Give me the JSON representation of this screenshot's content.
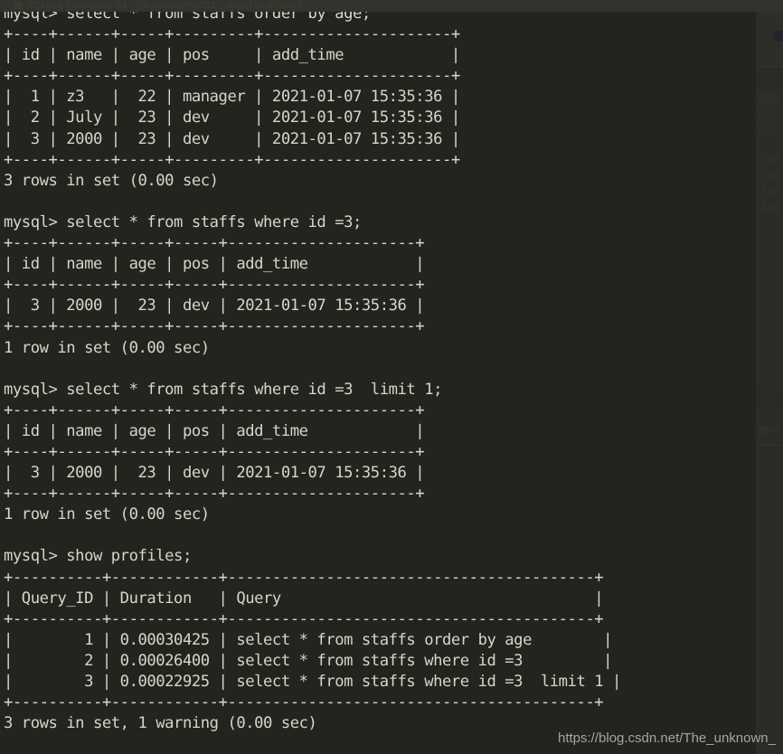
{
  "window": {
    "title": "SQLyog Enterprise 64 - [demo3/demo012 - root@localhost*]",
    "background_color": "#2b2b27",
    "console_background_color": "#24241f",
    "console_text_color": "#d6d6cd"
  },
  "watermark": {
    "text": "https://blog.csdn.net/The_unknown_"
  },
  "terminal": {
    "prompt": "mysql> ",
    "blocks": [
      {
        "name": "select-order-by-age",
        "command": "mysql> select * from staffs order by age;",
        "separator": "+----+------+-----+---------+---------------------+",
        "header": "| id | name | age | pos     | add_time            |",
        "rows": [
          "|  1 | z3   |  22 | manager | 2021-01-07 15:35:36 |",
          "|  2 | July |  23 | dev     | 2021-01-07 15:35:36 |",
          "|  3 | 2000 |  23 | dev     | 2021-01-07 15:35:36 |"
        ],
        "status": "3 rows in set (0.00 sec)"
      },
      {
        "name": "select-where-id-3",
        "command": "mysql> select * from staffs where id =3;",
        "separator": "+----+------+-----+-----+---------------------+",
        "header": "| id | name | age | pos | add_time            |",
        "rows": [
          "|  3 | 2000 |  23 | dev | 2021-01-07 15:35:36 |"
        ],
        "status": "1 row in set (0.00 sec)"
      },
      {
        "name": "select-where-id-3-limit-1",
        "command": "mysql> select * from staffs where id =3  limit 1;",
        "separator": "+----+------+-----+-----+---------------------+",
        "header": "| id | name | age | pos | add_time            |",
        "rows": [
          "|  3 | 2000 |  23 | dev | 2021-01-07 15:35:36 |"
        ],
        "status": "1 row in set (0.00 sec)"
      },
      {
        "name": "show-profiles",
        "command": "mysql> show profiles;",
        "separator": "+----------+------------+-----------------------------------------+",
        "header": "| Query_ID | Duration   | Query                                   |",
        "rows": [
          "|        1 | 0.00030425 | select * from staffs order by age       |",
          "|        2 | 0.00026400 | select * from staffs where id =3        |",
          "|        3 | 0.00022925 | select * from staffs where id =3  limit 1 |"
        ],
        "status": "3 rows in set, 1 warning (0.00 sec)"
      }
    ],
    "profiles_table": {
      "columns": [
        "Query_ID",
        "Duration",
        "Query"
      ],
      "data": [
        {
          "query_id": "1",
          "duration": "0.00030425",
          "query": "select * from staffs order by age"
        },
        {
          "query_id": "2",
          "duration": "0.00026400",
          "query": "select * from staffs where id =3"
        },
        {
          "query_id": "3",
          "duration": "0.00022925",
          "query": "select * from staffs where id =3  limit 1"
        }
      ]
    },
    "staffs_table": {
      "columns": [
        "id",
        "name",
        "age",
        "pos",
        "add_time"
      ],
      "data": [
        {
          "id": "1",
          "name": "z3",
          "age": "22",
          "pos": "manager",
          "add_time": "2021-01-07 15:35:36"
        },
        {
          "id": "2",
          "name": "July",
          "age": "23",
          "pos": "dev",
          "add_time": "2021-01-07 15:35:36"
        },
        {
          "id": "3",
          "name": "2000",
          "age": "23",
          "pos": "dev",
          "add_time": "2021-01-07 15:35:36"
        }
      ]
    },
    "screen_text": "mysql> select * from staffs order by age;\n+----+------+-----+---------+---------------------+\n| id | name | age | pos     | add_time            |\n+----+------+-----+---------+---------------------+\n|  1 | z3   |  22 | manager | 2021-01-07 15:35:36 |\n|  2 | July |  23 | dev     | 2021-01-07 15:35:36 |\n|  3 | 2000 |  23 | dev     | 2021-01-07 15:35:36 |\n+----+------+-----+---------+---------------------+\n3 rows in set (0.00 sec)\n\nmysql> select * from staffs where id =3;\n+----+------+-----+-----+---------------------+\n| id | name | age | pos | add_time            |\n+----+------+-----+-----+---------------------+\n|  3 | 2000 |  23 | dev | 2021-01-07 15:35:36 |\n+----+------+-----+-----+---------------------+\n1 row in set (0.00 sec)\n\nmysql> select * from staffs where id =3  limit 1;\n+----+------+-----+-----+---------------------+\n| id | name | age | pos | add_time            |\n+----+------+-----+-----+---------------------+\n|  3 | 2000 |  23 | dev | 2021-01-07 15:35:36 |\n+----+------+-----+-----+---------------------+\n1 row in set (0.00 sec)\n\nmysql> show profiles;\n+----------+------------+-----------------------------------------+\n| Query_ID | Duration   | Query                                   |\n+----------+------------+-----------------------------------------+\n|        1 | 0.00030425 | select * from staffs order by age        |\n|        2 | 0.00026400 | select * from staffs where id =3         |\n|        3 | 0.00022925 | select * from staffs where id =3  limit 1 |\n+----------+------------+-----------------------------------------+\n3 rows in set, 1 warning (0.00 sec)"
  }
}
